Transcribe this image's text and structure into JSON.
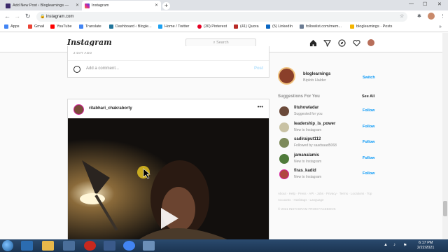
{
  "browser": {
    "tabs": [
      {
        "title": "Add New Post ‹ Bloglearnings —",
        "fav_color": "#3b2a6b"
      },
      {
        "title": "Instagram",
        "fav_color": "#d6249f"
      }
    ],
    "new_tab": "+",
    "url": "instagram.com",
    "bookmarks": [
      {
        "label": "Apps",
        "color": "#4285f4"
      },
      {
        "label": "Gmail",
        "color": "#ea4335"
      },
      {
        "label": "YouTube",
        "color": "#ff0000"
      },
      {
        "label": "Translate",
        "color": "#4285f4"
      },
      {
        "label": "Dashboard ‹ Bloglе...",
        "color": "#21759b"
      },
      {
        "label": "Home / Twitter",
        "color": "#1da1f2"
      },
      {
        "label": "(30) Pinterest",
        "color": "#e60023"
      },
      {
        "label": "(41) Quora",
        "color": "#b92b27"
      },
      {
        "label": "(5) LinkedIn",
        "color": "#0a66c2"
      },
      {
        "label": "followlist.com/mem...",
        "color": "#6b7c93"
      },
      {
        "label": "bloglearnings · Posts",
        "color": "#f4b400"
      }
    ]
  },
  "instagram": {
    "logo": "Instagram",
    "search_placeholder": "Search",
    "post1": {
      "time": "2 DAY AGO",
      "comment_placeholder": "Add a comment...",
      "post_label": "Post"
    },
    "post2": {
      "username": "ritabhari_chakraborty",
      "more": "•••"
    },
    "me": {
      "username": "bloglearnings",
      "name": "Biplob Halder",
      "switch_label": "Switch"
    },
    "suggestions_heading": "Suggestions For You",
    "see_all": "See All",
    "suggestions": [
      {
        "username": "lituhowladar",
        "sub": "Suggested for you",
        "follow": "Follow",
        "color": "#6b4a3a"
      },
      {
        "username": "leadership_is_power",
        "sub": "New to Instagram",
        "follow": "Follow",
        "color": "#c9c2a4"
      },
      {
        "username": "sadiraiput112",
        "sub": "Followed by saadsaad5068",
        "follow": "Follow",
        "color": "#7d8a5a"
      },
      {
        "username": "jamanalamis",
        "sub": "New to Instagram",
        "follow": "Follow",
        "color": "#4f7a3a"
      },
      {
        "username": "firas_kadid",
        "sub": "New to Instagram",
        "follow": "Follow",
        "color": "#b0463f"
      }
    ],
    "footer_links": "About · Help · Press · API · Jobs · Privacy · Terms · Locations · Top Accounts · Hashtags · Language",
    "copyright": "© 2021 INSTAGRAM FROM FACEBOOK"
  },
  "taskbar": {
    "time": "6:17 PM",
    "date": "2/22/2021"
  }
}
